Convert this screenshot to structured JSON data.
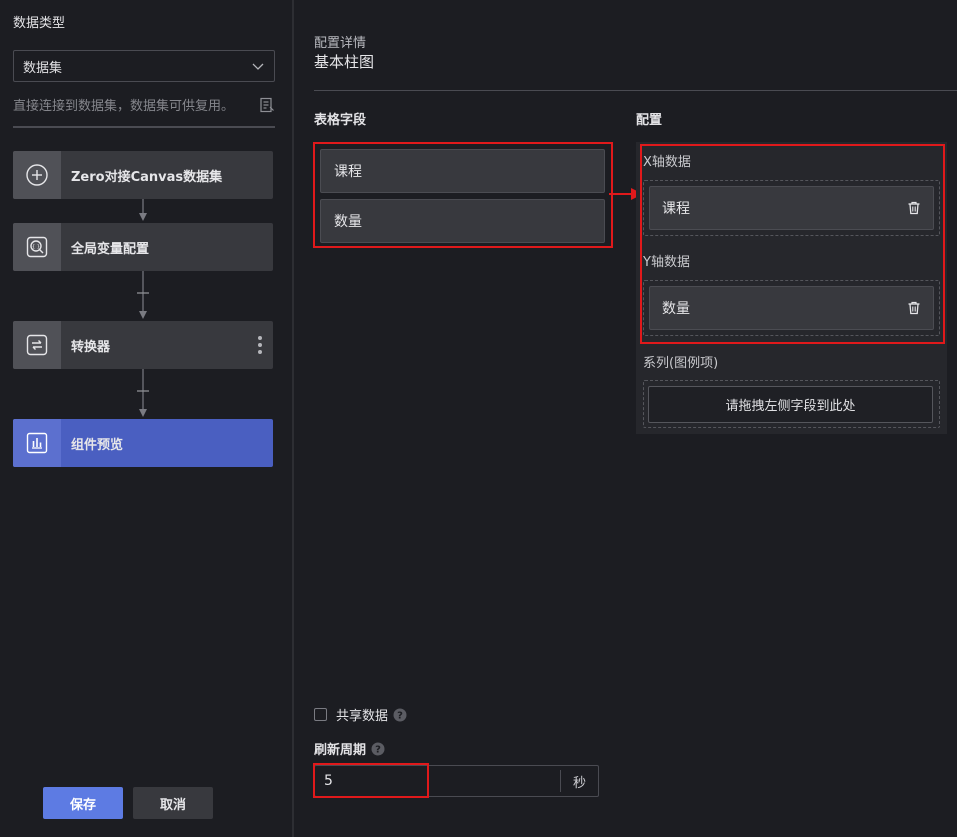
{
  "left": {
    "title": "数据类型",
    "select_value": "数据集",
    "description": "直接连接到数据集，数据集可供复用。",
    "nodes": [
      {
        "label": "Zero对接Canvas数据集",
        "icon": "plus-circle-icon"
      },
      {
        "label": "全局变量配置",
        "icon": "global-variable-icon"
      },
      {
        "label": "转换器",
        "icon": "convert-icon"
      },
      {
        "label": "组件预览",
        "icon": "bar-chart-icon",
        "active": true
      }
    ],
    "save_label": "保存",
    "cancel_label": "取消"
  },
  "right": {
    "subtitle": "配置详情",
    "title": "基本柱图",
    "fields_title": "表格字段",
    "config_title": "配置",
    "fields": [
      "课程",
      "数量"
    ],
    "x_axis": {
      "label": "X轴数据",
      "item": "课程"
    },
    "y_axis": {
      "label": "Y轴数据",
      "item": "数量"
    },
    "series": {
      "label": "系列(图例项)",
      "placeholder": "请拖拽左侧字段到此处"
    },
    "share_data_label": "共享数据",
    "refresh_label": "刷新周期",
    "refresh_value": "5",
    "refresh_unit": "秒"
  },
  "colors": {
    "accent": "#5d7be3",
    "active_node": "#4a5fc1",
    "highlight": "#e0191b"
  }
}
